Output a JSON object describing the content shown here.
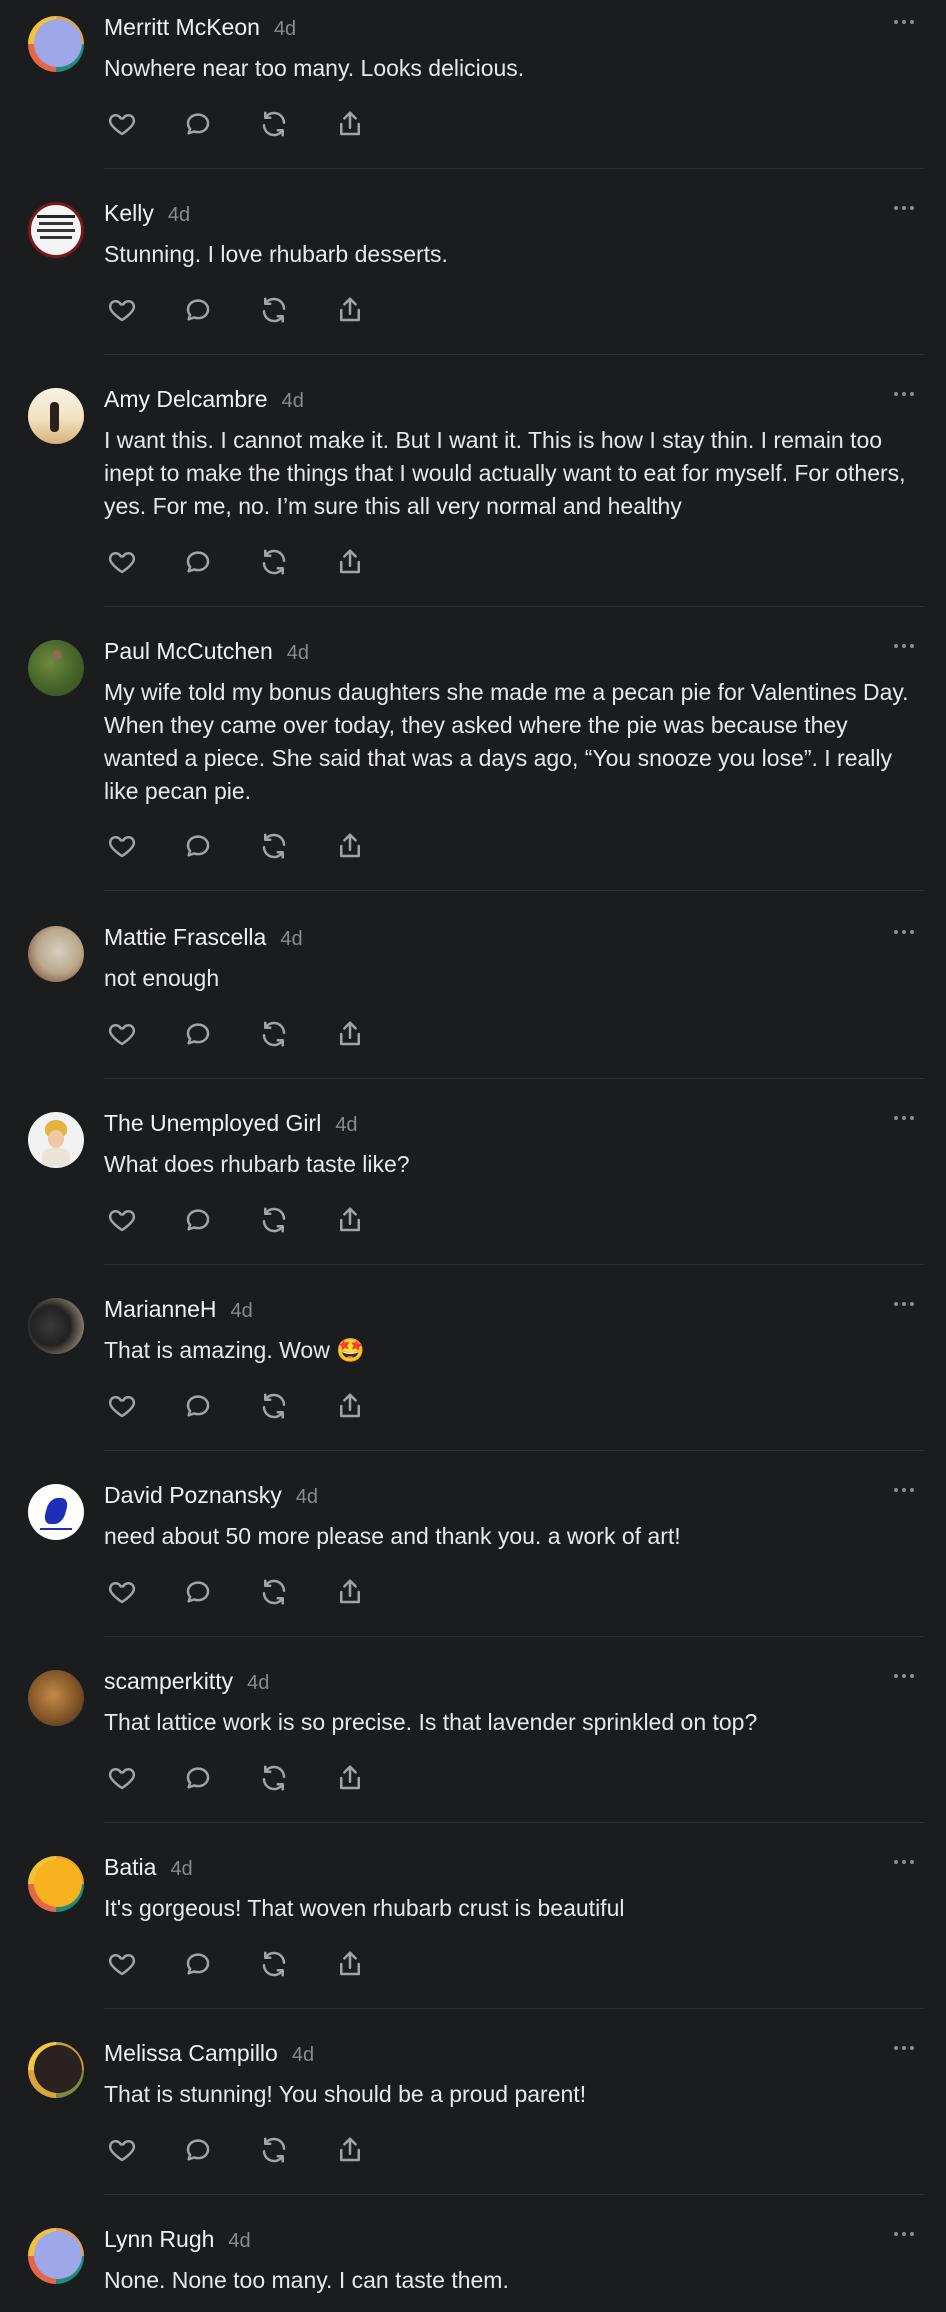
{
  "colors": {
    "background": "#1b1c1e",
    "divider": "#2f3033",
    "muted": "#8a8a8c",
    "icon": "#a3a3a5"
  },
  "action_icons": [
    "heart-icon",
    "comment-icon",
    "restack-icon",
    "share-icon"
  ],
  "comments": [
    {
      "name": "Merritt McKeon",
      "time": "4d",
      "text": "Nowhere near too many. Looks delicious.",
      "avatar": "ring-periwinkle"
    },
    {
      "name": "Kelly",
      "time": "4d",
      "text": "Stunning. I love rhubarb desserts.",
      "avatar": "sign-photo"
    },
    {
      "name": "Amy Delcambre",
      "time": "4d",
      "text": "I want this. I cannot make it. But I want it. This is how I stay thin. I remain too inept to make the things that I would actually want to eat for myself. For others, yes. For me, no. I’m sure this all very normal and healthy",
      "avatar": "sunset-photo"
    },
    {
      "name": "Paul McCutchen",
      "time": "4d",
      "text": "My wife told my bonus daughters she made me a pecan pie for Valentines Day. When they came over today, they asked where the pie was because they wanted a piece. She said that was a days ago, “You snooze you lose”. I really like pecan pie.",
      "avatar": "garden-photo"
    },
    {
      "name": "Mattie Frascella",
      "time": "4d",
      "text": "not enough",
      "avatar": "statue-photo"
    },
    {
      "name": "The Unemployed Girl",
      "time": "4d",
      "text": "What does rhubarb taste like?",
      "avatar": "doll-photo"
    },
    {
      "name": "MarianneH",
      "time": "4d",
      "text": "That is amazing. Wow 🤩",
      "avatar": "dog-photo"
    },
    {
      "name": "David Poznansky",
      "time": "4d",
      "text": "need about 50 more please and thank you. a work of art!",
      "avatar": "runner-logo"
    },
    {
      "name": "scamperkitty",
      "time": "4d",
      "text": "That lattice work is so precise. Is that lavender sprinkled on top?",
      "avatar": "cat-photo"
    },
    {
      "name": "Batia",
      "time": "4d",
      "text": "It's gorgeous! That woven rhubarb crust is beautiful",
      "avatar": "ring-orange"
    },
    {
      "name": "Melissa Campillo",
      "time": "4d",
      "text": "That is stunning! You should be a proud parent!",
      "avatar": "ring-dark"
    },
    {
      "name": "Lynn Rugh",
      "time": "4d",
      "text": "None. None too many. I can taste them.",
      "avatar": "ring-periwinkle"
    }
  ]
}
